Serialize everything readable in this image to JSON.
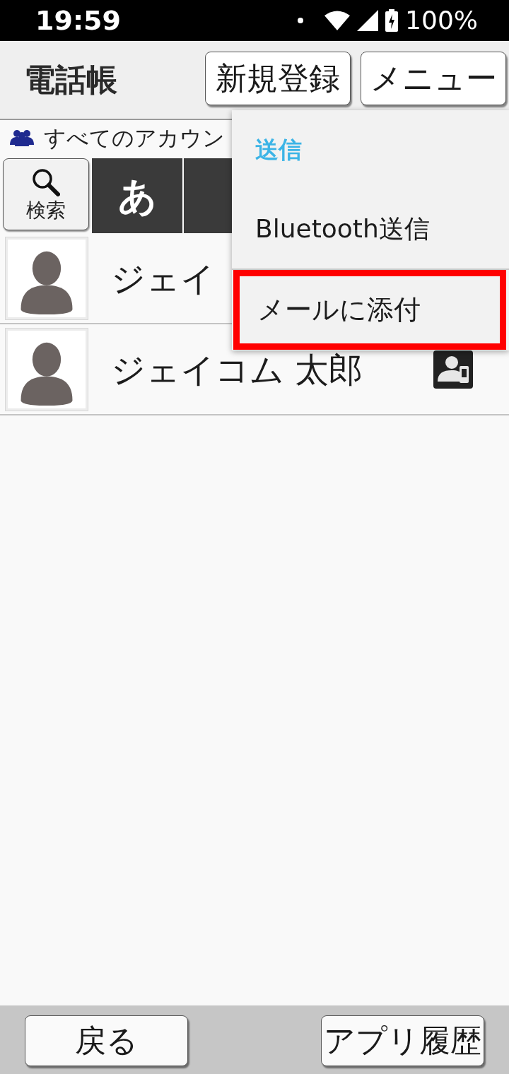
{
  "status_bar": {
    "time": "19:59",
    "battery": "100%"
  },
  "header": {
    "title": "電話帳",
    "buttons": [
      "新規登録",
      "メニュー"
    ]
  },
  "account_filter": {
    "label": "すべてのアカウン"
  },
  "search_button": {
    "label": "検索"
  },
  "index": [
    "あ"
  ],
  "contacts": [
    {
      "name": "ジェイ",
      "badge": false
    },
    {
      "name": "ジェイコム 太郎",
      "badge": true
    }
  ],
  "menu": {
    "title": "送信",
    "items": [
      {
        "label": "Bluetooth送信",
        "highlighted": false
      },
      {
        "label": "メールに添付",
        "highlighted": true
      }
    ]
  },
  "footer": {
    "buttons": [
      "戻る",
      "アプリ履歴"
    ]
  }
}
